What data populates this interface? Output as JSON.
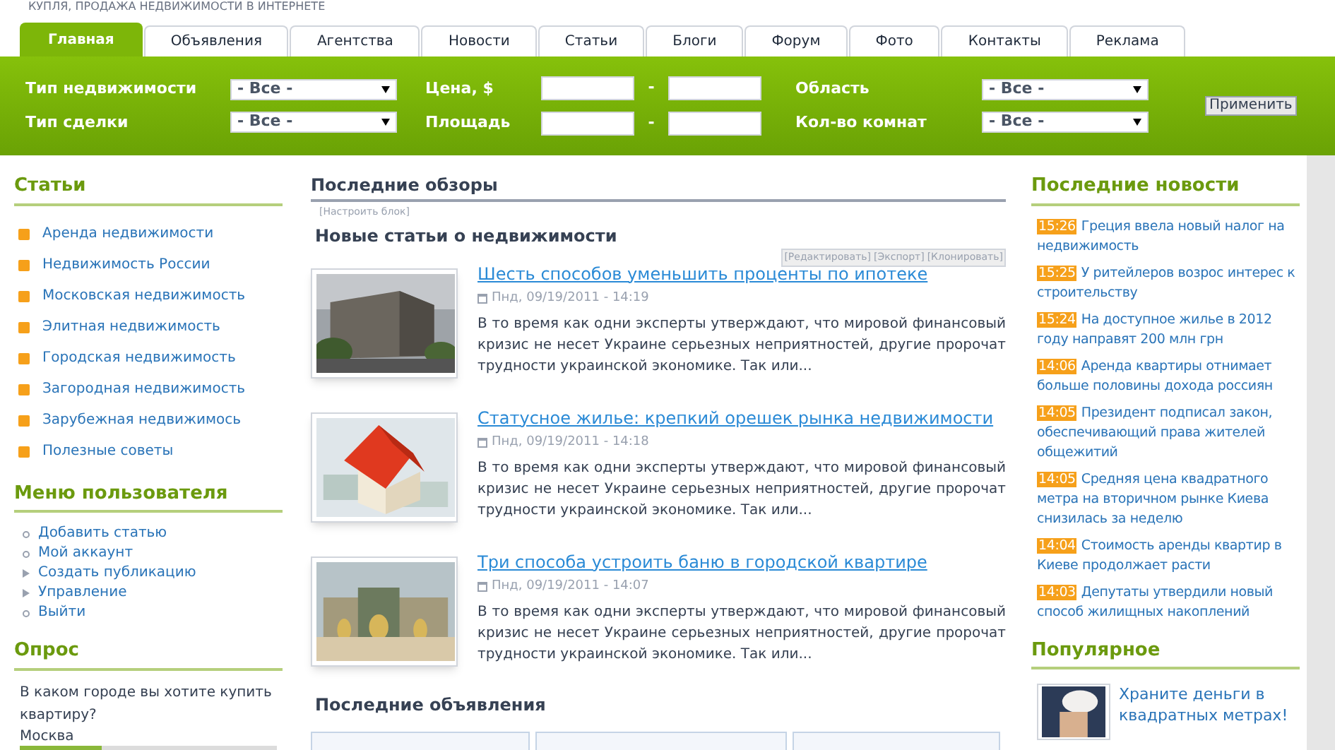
{
  "site_tagline": "КУПЛЯ, ПРОДАЖА НЕДВИЖИМОСТИ В ИНТЕРНЕТЕ",
  "tabs": [
    {
      "label": "Главная",
      "selected": true
    },
    {
      "label": "Объявления",
      "selected": false
    },
    {
      "label": "Агентства",
      "selected": false
    },
    {
      "label": "Новости",
      "selected": false
    },
    {
      "label": "Статьи",
      "selected": false
    },
    {
      "label": "Блоги",
      "selected": false
    },
    {
      "label": "Форум",
      "selected": false
    },
    {
      "label": "Фото",
      "selected": false
    },
    {
      "label": "Контакты",
      "selected": false
    },
    {
      "label": "Реклама",
      "selected": false
    }
  ],
  "filters": {
    "property_type": {
      "label": "Тип недвижимости",
      "value": "- Все -"
    },
    "deal_type": {
      "label": "Тип сделки",
      "value": "- Все -"
    },
    "price": {
      "label": "Цена, $",
      "separator": "-"
    },
    "area": {
      "label": "Площадь",
      "separator": "-"
    },
    "region": {
      "label": "Область",
      "value": "- Все -"
    },
    "rooms": {
      "label": "Кол-во комнат",
      "value": "- Все -"
    },
    "apply_button": "Применить"
  },
  "articles_menu": {
    "title": "Статьи",
    "items": [
      "Аренда недвижимости",
      "Недвижимость России",
      "Московская недвижимость",
      "Элитная недвижимость",
      "Городская недвижимость",
      "Загородная недвижимость",
      "Зарубежная недвижимось",
      "Полезные советы"
    ]
  },
  "user_menu": {
    "title": "Меню пользователя",
    "items": [
      {
        "label": "Добавить статью",
        "kind": "leaf"
      },
      {
        "label": "Мой аккаунт",
        "kind": "leaf"
      },
      {
        "label": "Создать публикацию",
        "kind": "collapsed"
      },
      {
        "label": "Управление",
        "kind": "collapsed"
      },
      {
        "label": "Выйти",
        "kind": "leaf"
      }
    ]
  },
  "poll": {
    "title": "Опрос",
    "question": "В каком городе вы хотите купить квартиру?",
    "options": [
      {
        "label": "Москва",
        "level": 0.32
      }
    ]
  },
  "reviews": {
    "title": "Последние обзоры",
    "configure_link": "[Настроить блок]",
    "subtitle": "Новые статьи о недвижимости",
    "admin_links": [
      "[Редактировать]",
      "[Экспорт]",
      "[Клонировать]"
    ],
    "articles": [
      {
        "title": "Шесть способов уменьшить проценты по ипотеке",
        "date": "Пнд, 09/19/2011 - 14:19",
        "excerpt": "В то время как одни эксперты утверждают, что мировой финансовый кризис не несет Украине серьезных неприятностей, другие пророчат трудности украинской экономике. Так или...",
        "kind": "building"
      },
      {
        "title": "Статусное жилье: крепкий орешек рынка недвижимости",
        "date": "Пнд, 09/19/2011 - 14:18",
        "excerpt": "В то время как одни эксперты утверждают, что мировой финансовый кризис не несет Украине серьезных неприятностей, другие пророчат трудности украинской экономике. Так или...",
        "kind": "house"
      },
      {
        "title": "Три способа устроить баню в городской квартире",
        "date": "Пнд, 09/19/2011 - 14:07",
        "excerpt": "В то время как одни эксперты утверждают, что мировой финансовый кризис не несет Украине серьезных неприятностей, другие пророчат трудности украинской экономике. Так или...",
        "kind": "palace"
      }
    ]
  },
  "ads": {
    "title": "Последние объявления"
  },
  "news": {
    "title": "Последние новости",
    "items": [
      {
        "time": "15:26",
        "title": "Греция ввела новый налог на недвижимость"
      },
      {
        "time": "15:25",
        "title": "У ритейлеров возрос интерес к строительству"
      },
      {
        "time": "15:24",
        "title": "На доступное жилье в 2012 году направят 200 млн грн"
      },
      {
        "time": "14:06",
        "title": "Аренда квартиры отнимает больше половины дохода россиян"
      },
      {
        "time": "14:05",
        "title": "Президент подписал закон, обеспечивающий права жителей общежитий"
      },
      {
        "time": "14:05",
        "title": "Средняя цена квадратного метра на вторичном рынке Киева снизилась за неделю"
      },
      {
        "time": "14:04",
        "title": "Стоимость аренды квартир в Киеве продолжает расти"
      },
      {
        "time": "14:03",
        "title": "Депутаты утвердили новый способ жилищных накоплений"
      }
    ]
  },
  "popular": {
    "title": "Популярное",
    "items": [
      "Храните деньги в квадратных метрах!"
    ]
  }
}
